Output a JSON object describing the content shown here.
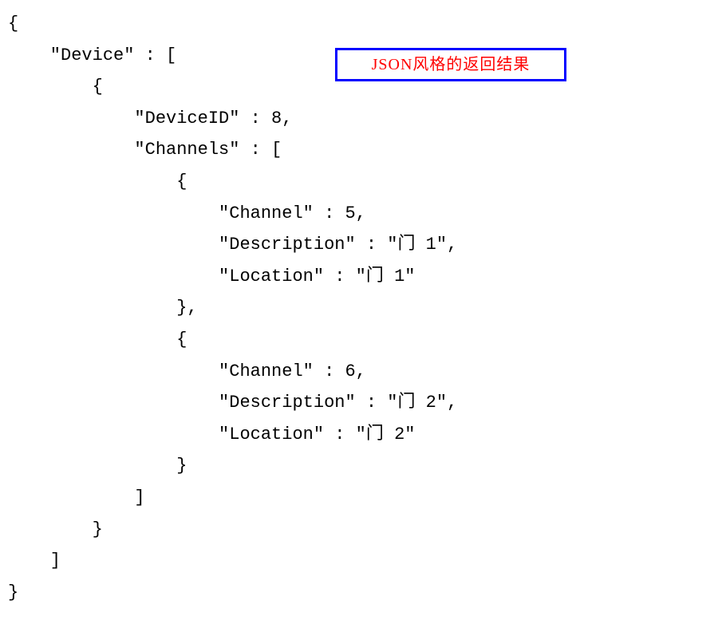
{
  "annotation": {
    "label": "JSON风格的返回结果"
  },
  "code": {
    "line01": "{",
    "line02": "    \"Device\" : [",
    "line03": "        {",
    "line04": "            \"DeviceID\" : 8,",
    "line05": "            \"Channels\" : [",
    "line06": "                {",
    "line07": "                    \"Channel\" : 5,",
    "line08": "                    \"Description\" : \"门 1\",",
    "line09": "                    \"Location\" : \"门 1\"",
    "line10": "                },",
    "line11": "                {",
    "line12": "                    \"Channel\" : 6,",
    "line13": "                    \"Description\" : \"门 2\",",
    "line14": "                    \"Location\" : \"门 2\"",
    "line15": "                }",
    "line16": "            ]",
    "line17": "        }",
    "line18": "    ]",
    "line19": "}"
  }
}
